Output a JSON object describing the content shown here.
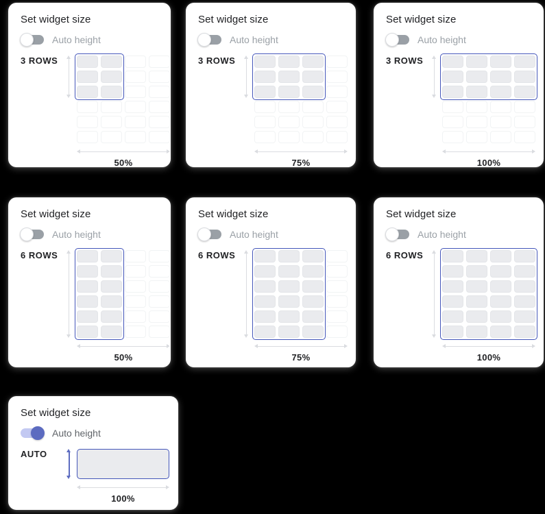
{
  "background_color": "#000000",
  "theme": {
    "card_bg": "#ffffff",
    "title_color": "#202124",
    "muted_text": "#9aa0a6",
    "accent": "#5c6bc0",
    "selection_border": "#4355b9",
    "selected_cell_fill": "#eaebee",
    "empty_cell_border": "#f1f3f4",
    "ruler_color": "#dadce0"
  },
  "grid": {
    "columns": 4,
    "rows": 6
  },
  "cards": [
    {
      "id": "card-3rows-50",
      "title": "Set widget size",
      "toggle": {
        "label": "Auto height",
        "on": false
      },
      "rows_label": "3 ROWS",
      "percent": "50%",
      "mode": "grid",
      "selected_cols": 2,
      "selected_rows": 3
    },
    {
      "id": "card-3rows-75",
      "title": "Set widget size",
      "toggle": {
        "label": "Auto height",
        "on": false
      },
      "rows_label": "3 ROWS",
      "percent": "75%",
      "mode": "grid",
      "selected_cols": 3,
      "selected_rows": 3
    },
    {
      "id": "card-3rows-100",
      "title": "Set widget size",
      "toggle": {
        "label": "Auto height",
        "on": false
      },
      "rows_label": "3 ROWS",
      "percent": "100%",
      "mode": "grid",
      "selected_cols": 4,
      "selected_rows": 3
    },
    {
      "id": "card-6rows-50",
      "title": "Set widget size",
      "toggle": {
        "label": "Auto height",
        "on": false
      },
      "rows_label": "6 ROWS",
      "percent": "50%",
      "mode": "grid",
      "selected_cols": 2,
      "selected_rows": 6
    },
    {
      "id": "card-6rows-75",
      "title": "Set widget size",
      "toggle": {
        "label": "Auto height",
        "on": false
      },
      "rows_label": "6 ROWS",
      "percent": "75%",
      "mode": "grid",
      "selected_cols": 3,
      "selected_rows": 6
    },
    {
      "id": "card-6rows-100",
      "title": "Set widget size",
      "toggle": {
        "label": "Auto height",
        "on": false
      },
      "rows_label": "6 ROWS",
      "percent": "100%",
      "mode": "grid",
      "selected_cols": 4,
      "selected_rows": 6
    },
    {
      "id": "card-auto-100",
      "title": "Set widget size",
      "toggle": {
        "label": "Auto height",
        "on": true
      },
      "rows_label": "AUTO",
      "percent": "100%",
      "mode": "auto",
      "selected_cols": 4,
      "selected_rows": 0
    }
  ],
  "icons": {
    "vertical_ruler": "vertical-dimension-arrow-icon",
    "horizontal_ruler": "horizontal-dimension-arrow-icon",
    "toggle_knob": "toggle-knob-icon"
  }
}
